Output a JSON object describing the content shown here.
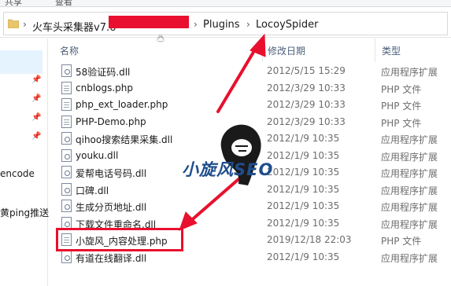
{
  "ribbon": {
    "tabs": [
      "共享",
      "查看"
    ]
  },
  "address": {
    "segments": [
      "火车头采集器v7.6",
      "Plugins",
      "LocoySpider"
    ],
    "separator": "›"
  },
  "sidebar": {
    "items": [
      "encode",
      "黄ping推送"
    ]
  },
  "columns": {
    "name": "名称",
    "date": "修改日期",
    "type": "类型"
  },
  "files": [
    {
      "name": "58验证码.dll",
      "date": "2012/5/15 15:29",
      "type": "应用程序扩展",
      "icon": "dll-gear-icon"
    },
    {
      "name": "cnblogs.php",
      "date": "2012/3/29 10:33",
      "type": "PHP 文件",
      "icon": "php-file-icon"
    },
    {
      "name": "php_ext_loader.php",
      "date": "2012/3/29 10:33",
      "type": "PHP 文件",
      "icon": "php-file-icon"
    },
    {
      "name": "PHP-Demo.php",
      "date": "2012/3/29 10:33",
      "type": "PHP 文件",
      "icon": "php-file-icon"
    },
    {
      "name": "qihoo搜索结果采集.dll",
      "date": "2012/1/9 10:35",
      "type": "应用程序扩展",
      "icon": "dll-gear-icon"
    },
    {
      "name": "youku.dll",
      "date": "2012/1/9 10:35",
      "type": "应用程序扩展",
      "icon": "dll-gear-icon"
    },
    {
      "name": "爱帮电话号码.dll",
      "date": "2012/1/9 10:35",
      "type": "应用程序扩展",
      "icon": "dll-gear-icon"
    },
    {
      "name": "口碑.dll",
      "date": "2012/1/9 10:35",
      "type": "应用程序扩展",
      "icon": "dll-gear-icon"
    },
    {
      "name": "生成分页地址.dll",
      "date": "2012/1/9 10:35",
      "type": "应用程序扩展",
      "icon": "dll-gear-icon"
    },
    {
      "name": "下载文件重命名.dll",
      "date": "2012/1/9 10:35",
      "type": "应用程序扩展",
      "icon": "dll-gear-icon"
    },
    {
      "name": "小旋风_内容处理.php",
      "date": "2019/12/18 22:03",
      "type": "PHP 文件",
      "icon": "php-file-icon"
    },
    {
      "name": "有道在线翻译.dll",
      "date": "2012/1/9 10:35",
      "type": "应用程序扩展",
      "icon": "dll-gear-icon"
    }
  ],
  "watermark": {
    "text": "小旋风SEO"
  },
  "colors": {
    "highlight": "#e8102e",
    "header": "#4c607a",
    "secondary": "#6d6d6d"
  }
}
